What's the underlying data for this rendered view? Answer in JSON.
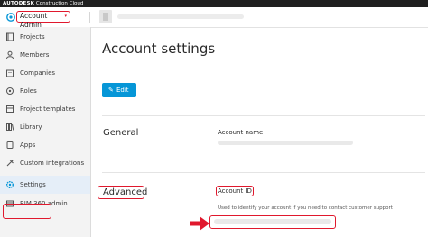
{
  "topbar": {
    "brand_bold": "AUTODESK",
    "brand_rest": "Construction Cloud"
  },
  "header": {
    "account_switcher_label": "Account Admin",
    "caret": "▾"
  },
  "sidebar": {
    "items": [
      {
        "label": "Projects",
        "icon": "projects-icon"
      },
      {
        "label": "Members",
        "icon": "members-icon"
      },
      {
        "label": "Companies",
        "icon": "companies-icon"
      },
      {
        "label": "Roles",
        "icon": "roles-icon"
      },
      {
        "label": "Project templates",
        "icon": "project-templates-icon"
      },
      {
        "label": "Library",
        "icon": "library-icon"
      },
      {
        "label": "Apps",
        "icon": "apps-icon"
      },
      {
        "label": "Custom integrations",
        "icon": "custom-integrations-icon"
      },
      {
        "label": "Settings",
        "icon": "settings-icon",
        "active": true
      },
      {
        "label": "BIM 360 admin",
        "icon": "bim360-icon"
      }
    ]
  },
  "main": {
    "title": "Account settings",
    "edit_button": "Edit",
    "general": {
      "heading": "General",
      "account_name_label": "Account name"
    },
    "advanced": {
      "heading": "Advanced",
      "account_id_label": "Account ID",
      "account_id_description": "Used to identify your account if you need to contact customer support"
    }
  },
  "colors": {
    "accent": "#0696d7",
    "highlight": "#e0182d",
    "sidebar_bg": "#f3f3f3",
    "topbar_bg": "#1f1f1f"
  }
}
